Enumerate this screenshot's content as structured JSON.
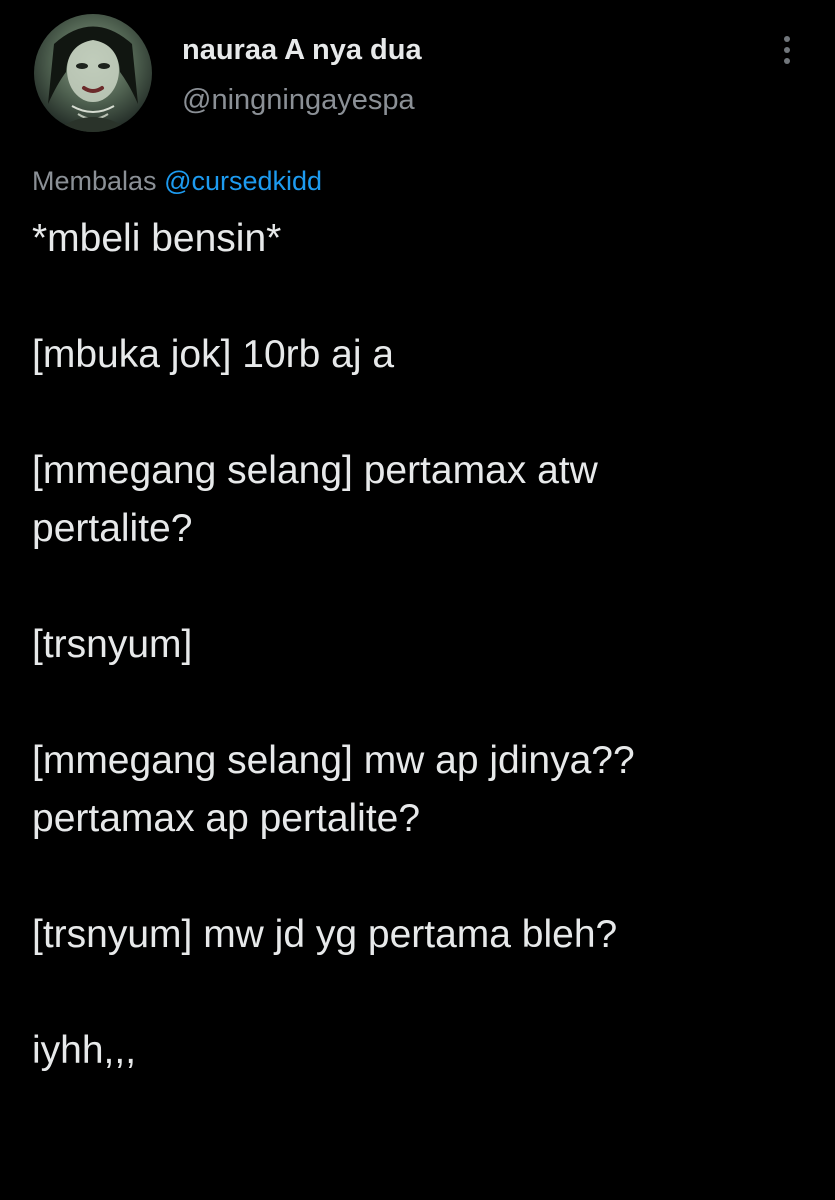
{
  "author": {
    "name": "nauraa A nya dua",
    "handle": "@ningningayespa"
  },
  "reply": {
    "prefix": "Membalas",
    "mention": "@cursedkidd"
  },
  "icons": {
    "more": "more-vertical-icon"
  },
  "colors": {
    "background": "#000000",
    "text": "#e7e9ea",
    "secondary_text": "#8b9096",
    "link": "#1d9bf0"
  },
  "tweet": {
    "paragraphs": [
      "*mbeli bensin*",
      "[mbuka jok] 10rb aj a",
      "[mmegang selang] pertamax atw\npertalite?",
      "[trsnyum]",
      "[mmegang selang] mw ap jdinya??\npertamax ap pertalite?",
      "[trsnyum] mw jd yg pertama bleh?",
      "iyhh,,,"
    ]
  }
}
